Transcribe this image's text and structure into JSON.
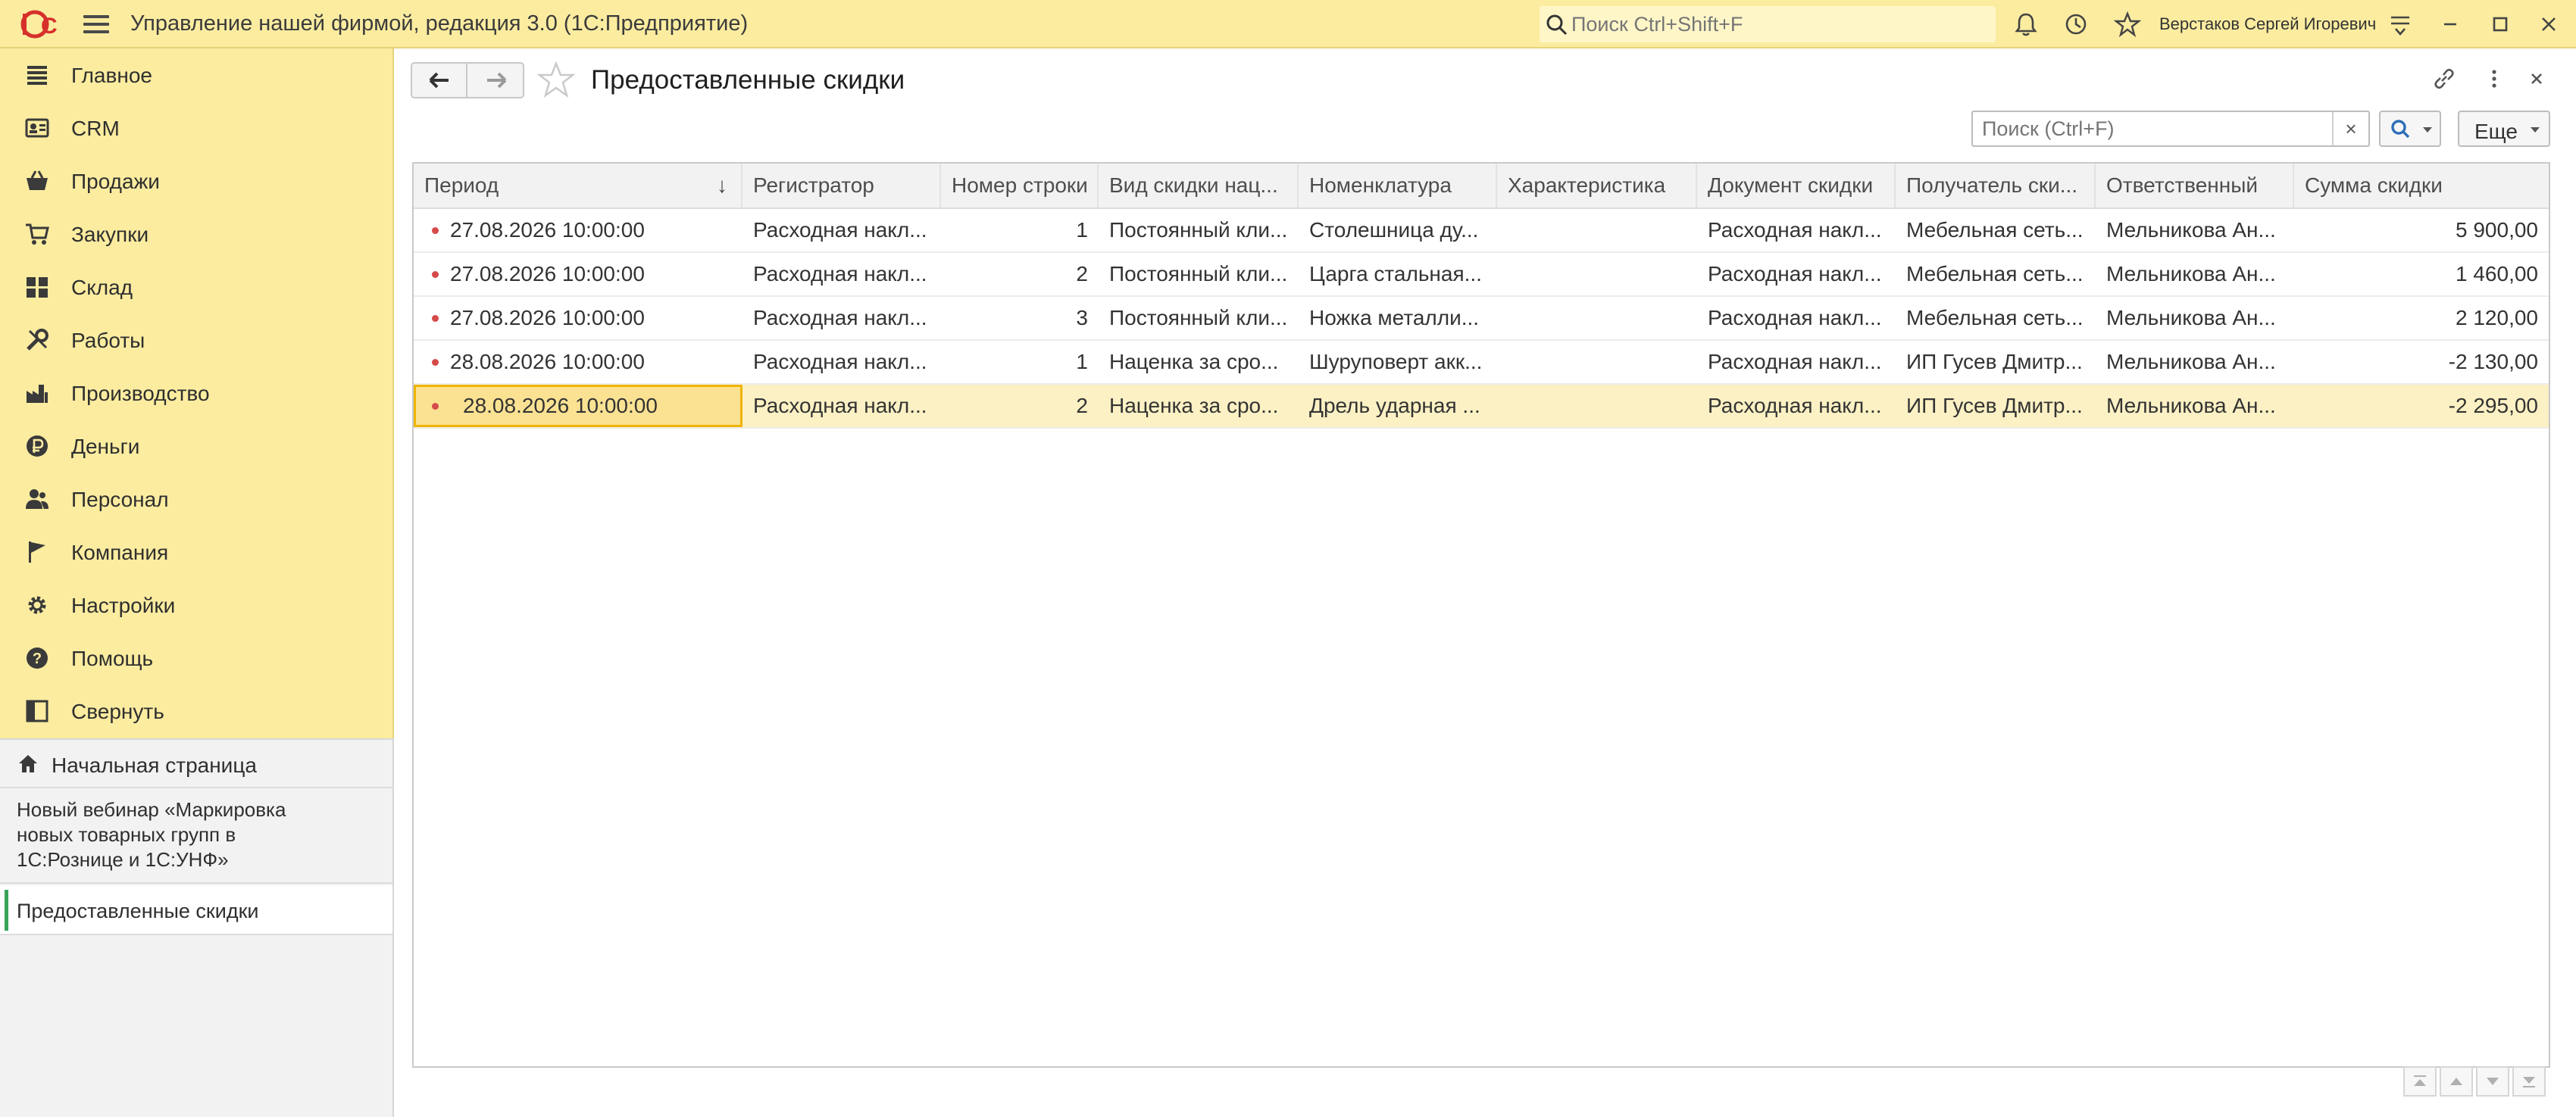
{
  "app": {
    "title": "Управление нашей фирмой, редакция 3.0  (1С:Предприятие)",
    "search_placeholder": "Поиск Ctrl+Shift+F",
    "user": "Верстаков Сергей Игоревич",
    "accent": "#fbeca0"
  },
  "sidebar": {
    "items": [
      {
        "label": "Главное",
        "icon": "list-icon"
      },
      {
        "label": "CRM",
        "icon": "contacts-icon"
      },
      {
        "label": "Продажи",
        "icon": "basket-icon"
      },
      {
        "label": "Закупки",
        "icon": "cart-icon"
      },
      {
        "label": "Склад",
        "icon": "warehouse-icon"
      },
      {
        "label": "Работы",
        "icon": "tools-icon"
      },
      {
        "label": "Производство",
        "icon": "factory-icon"
      },
      {
        "label": "Деньги",
        "icon": "ruble-icon"
      },
      {
        "label": "Персонал",
        "icon": "people-icon"
      },
      {
        "label": "Компания",
        "icon": "flag-icon"
      },
      {
        "label": "Настройки",
        "icon": "gear-icon"
      },
      {
        "label": "Помощь",
        "icon": "help-icon"
      },
      {
        "label": "Свернуть",
        "icon": "collapse-icon"
      }
    ],
    "home": "Начальная страница",
    "webinar": "Новый вебинар «Маркировка новых товарных групп в 1С:Рознице и 1С:УНФ»",
    "open_tab": "Предоставленные скидки"
  },
  "main": {
    "title": "Предоставленные скидки",
    "search_placeholder": "Поиск (Ctrl+F)",
    "clear": "×",
    "more": "Еще"
  },
  "table": {
    "columns": [
      "Период",
      "Регистратор",
      "Номер строки",
      "Вид скидки нац...",
      "Номенклатура",
      "Характеристика",
      "Документ скидки",
      "Получатель ски...",
      "Ответственный",
      "Сумма скидки"
    ],
    "sort_indicator": "↓",
    "rows": [
      [
        "27.08.2026 10:00:00",
        "Расходная накл...",
        "1",
        "Постоянный кли...",
        "Столешница ду...",
        "",
        "Расходная накл...",
        "Мебельная сеть...",
        "Мельникова Ан...",
        "5 900,00"
      ],
      [
        "27.08.2026 10:00:00",
        "Расходная накл...",
        "2",
        "Постоянный кли...",
        "Царга стальная...",
        "",
        "Расходная накл...",
        "Мебельная сеть...",
        "Мельникова Ан...",
        "1 460,00"
      ],
      [
        "27.08.2026 10:00:00",
        "Расходная накл...",
        "3",
        "Постоянный кли...",
        "Ножка металли...",
        "",
        "Расходная накл...",
        "Мебельная сеть...",
        "Мельникова Ан...",
        "2 120,00"
      ],
      [
        "28.08.2026 10:00:00",
        "Расходная накл...",
        "1",
        "Наценка за сро...",
        "Шуруповерт акк...",
        "",
        "Расходная накл...",
        "ИП Гусев Дмитр...",
        "Мельникова Ан...",
        "-2 130,00"
      ],
      [
        "28.08.2026 10:00:00",
        "Расходная накл...",
        "2",
        "Наценка за сро...",
        "Дрель ударная ...",
        "",
        "Расходная накл...",
        "ИП Гусев Дмитр...",
        "Мельникова Ан...",
        "-2 295,00"
      ]
    ],
    "selected_row": 4
  }
}
